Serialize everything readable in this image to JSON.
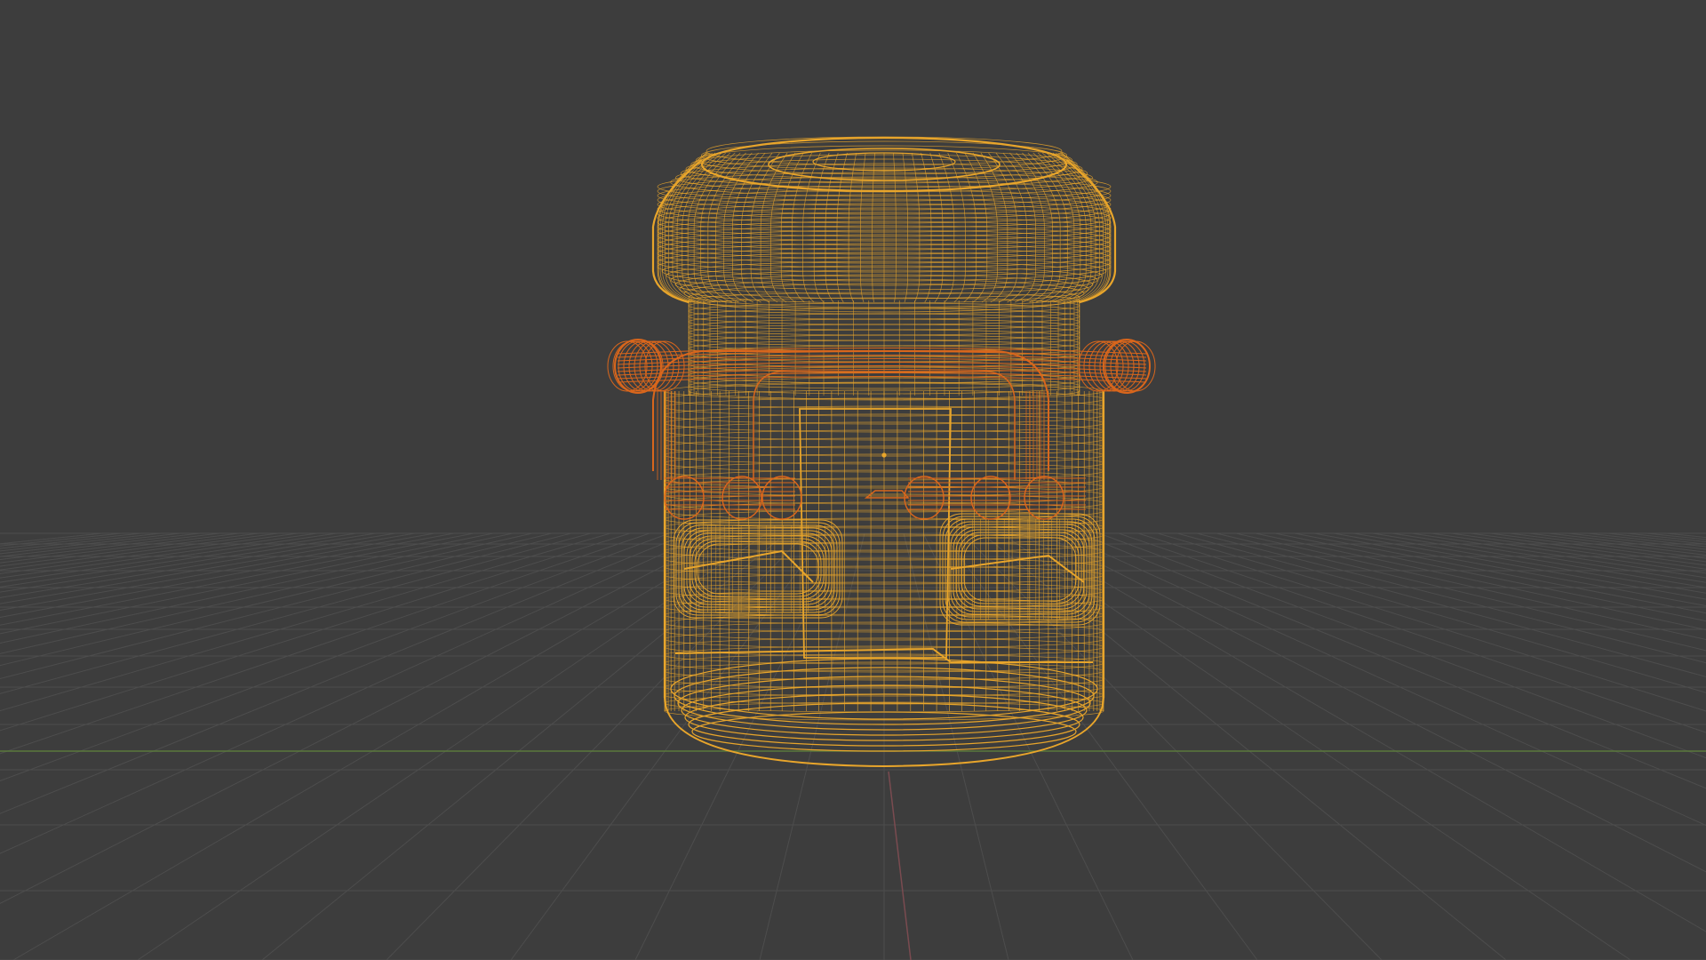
{
  "viewport": {
    "mode": "wireframe",
    "background_color": "#3d3d3d",
    "grid_color": "#4d4d4d",
    "x_axis_color": "#7a4b50",
    "y_axis_color": "#5b7a3c"
  },
  "scene": {
    "objects": [
      {
        "name": "jar",
        "selected": true,
        "active": true,
        "wire_color": "#e8a52b"
      },
      {
        "name": "handles",
        "selected": true,
        "active": false,
        "wire_color": "#d9661c"
      }
    ]
  }
}
